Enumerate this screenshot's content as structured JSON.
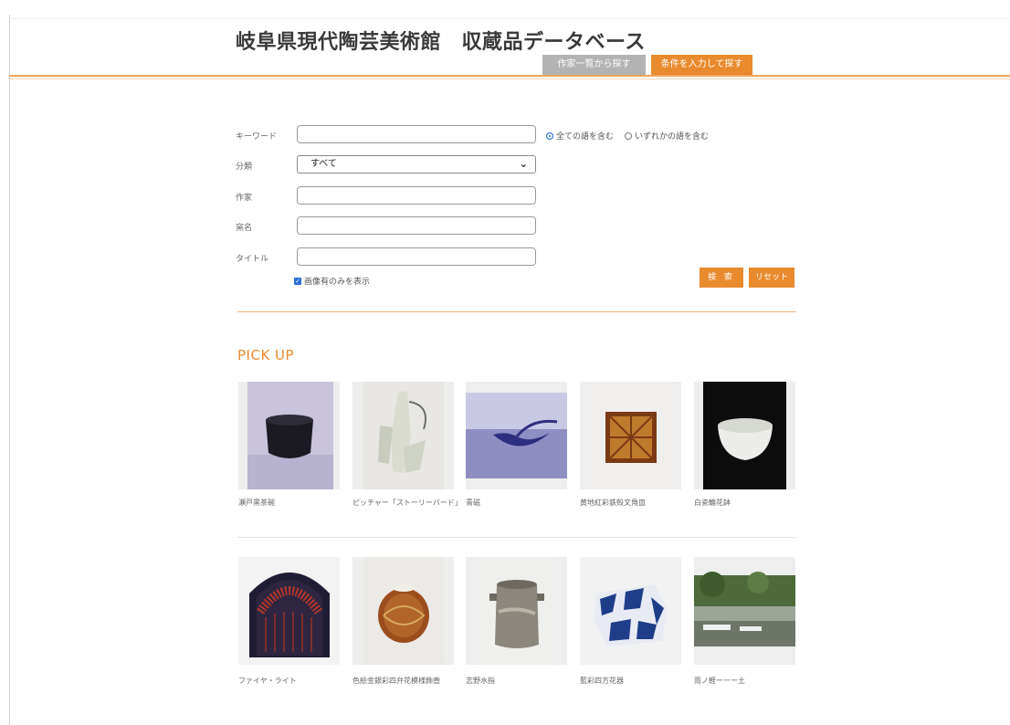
{
  "header": {
    "title": "岐阜県現代陶芸美術館　収蔵品データベース",
    "tabs": [
      {
        "label": "作家一覧から探す",
        "active": false
      },
      {
        "label": "条件を入力して探す",
        "active": true
      }
    ]
  },
  "search_form": {
    "keyword": {
      "label": "キーワード",
      "value": "",
      "placeholder": ""
    },
    "match_options": [
      {
        "label": "全ての語を含む",
        "selected": true
      },
      {
        "label": "いずれかの語を含む",
        "selected": false
      }
    ],
    "category": {
      "label": "分類",
      "selected": "すべて"
    },
    "artist": {
      "label": "作家",
      "value": ""
    },
    "pottery_name": {
      "label": "窯名",
      "value": ""
    },
    "title": {
      "label": "タイトル",
      "value": ""
    },
    "images_only": {
      "label": "画像有のみを表示",
      "checked": true
    },
    "search_button": "検 索",
    "reset_button": "リセット"
  },
  "pickup": {
    "heading": "PICK UP",
    "items": [
      {
        "caption": "瀬戸黒茶碗"
      },
      {
        "caption": "ピッチャー「ストーリーバード」"
      },
      {
        "caption": "青磁"
      },
      {
        "caption": "黄地紅彩鉄殻文角皿"
      },
      {
        "caption": "白瓷輪花鉢"
      },
      {
        "caption": "ファイヤ・ライト"
      },
      {
        "caption": "色絵金銀彩四弁花模様飾壺"
      },
      {
        "caption": "志野水指"
      },
      {
        "caption": "藍彩四方花器"
      },
      {
        "caption": "雨ノ軽ーーー土"
      }
    ]
  },
  "colors": {
    "accent": "#e98a2e",
    "tab_inactive": "#b3b3b3",
    "link_blue": "#2a6fd6"
  }
}
